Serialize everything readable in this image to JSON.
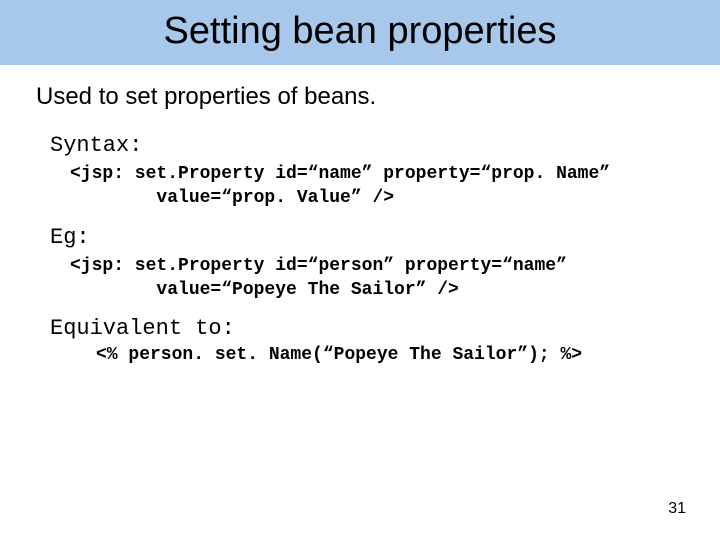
{
  "title": "Setting bean properties",
  "lead": "Used to set properties of beans.",
  "syntax_label": "Syntax:",
  "syntax_code": "<jsp: set.Property id=“name” property=“prop. Name”\n        value=“prop. Value” />",
  "eg_label": "Eg:",
  "eg_code": "<jsp: set.Property id=“person” property=“name”\n        value=“Popeye The Sailor” />",
  "equiv_label": "Equivalent to:",
  "equiv_code": "<% person. set. Name(“Popeye The Sailor”); %>",
  "page_number": "31"
}
